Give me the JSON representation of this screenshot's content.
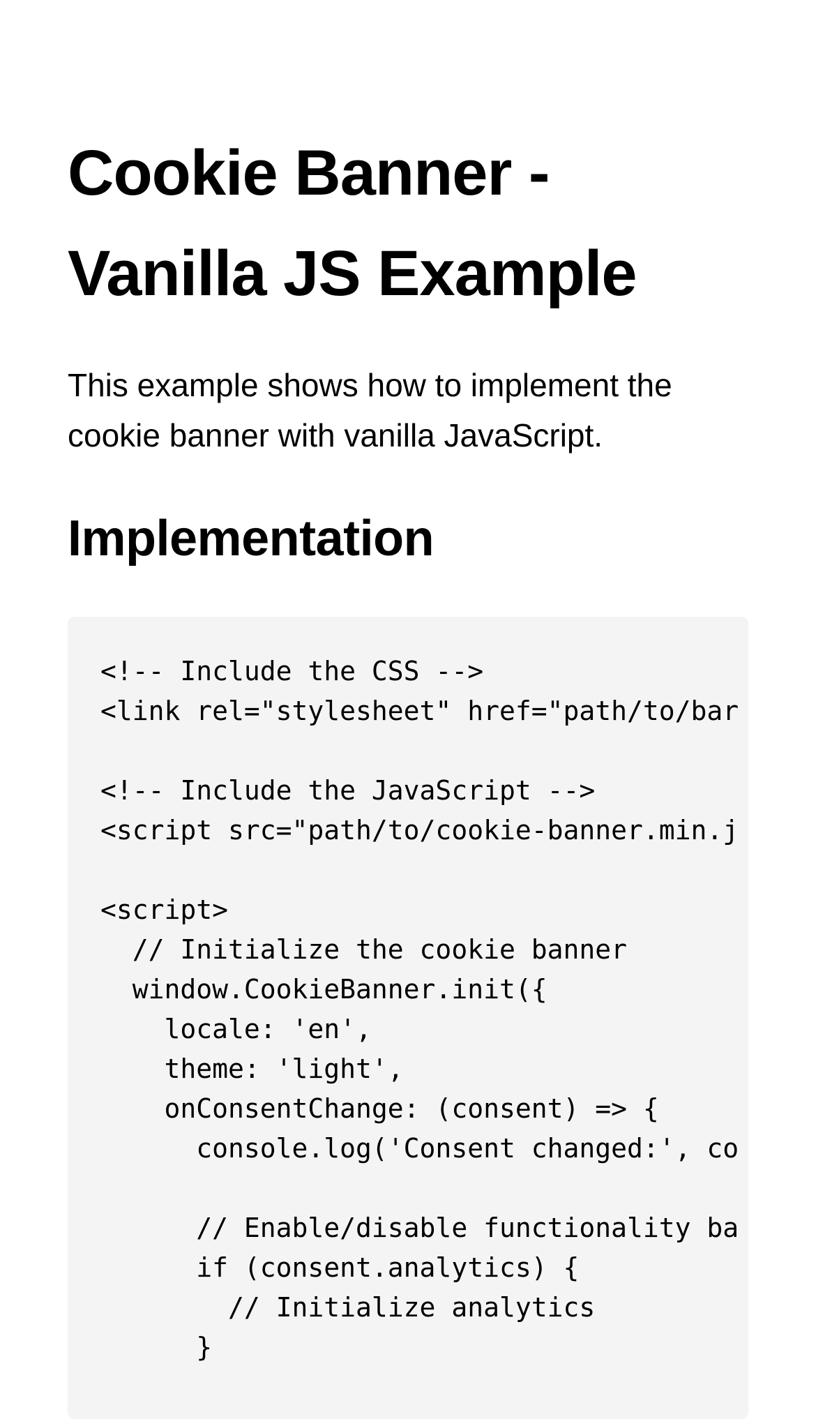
{
  "page": {
    "title": "Cookie Banner - Vanilla JS Example",
    "intro": "This example shows how to implement the cookie banner with vanilla JavaScript.",
    "section_heading": "Implementation"
  },
  "code": {
    "lines": [
      "<!-- Include the CSS -->",
      "<link rel=\"stylesheet\" href=\"path/to/bar",
      "",
      "<!-- Include the JavaScript -->",
      "<script src=\"path/to/cookie-banner.min.j",
      "",
      "<script>",
      "  // Initialize the cookie banner",
      "  window.CookieBanner.init({",
      "    locale: 'en',",
      "    theme: 'light',",
      "    onConsentChange: (consent) => {",
      "      console.log('Consent changed:', co",
      "",
      "      // Enable/disable functionality ba",
      "      if (consent.analytics) {",
      "        // Initialize analytics",
      "      }"
    ]
  }
}
